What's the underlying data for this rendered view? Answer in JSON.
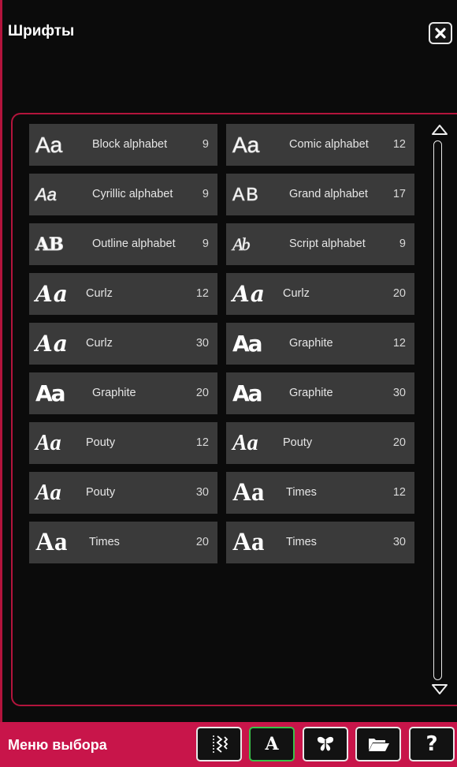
{
  "header": {
    "title": "Шрифты"
  },
  "fonts": [
    {
      "glyph": "Aa",
      "name": "Block alphabet",
      "size": "9",
      "style": "block"
    },
    {
      "glyph": "Aa",
      "name": "Comic alphabet",
      "size": "12",
      "style": "comic"
    },
    {
      "glyph": "Aa",
      "name": "Cyrillic alphabet",
      "size": "9",
      "style": "cyr"
    },
    {
      "glyph": "AB",
      "name": "Grand alphabet",
      "size": "17",
      "style": "grand"
    },
    {
      "glyph": "AB",
      "name": "Outline alphabet",
      "size": "9",
      "style": "outline"
    },
    {
      "glyph": "Ab",
      "name": "Script alphabet",
      "size": "9",
      "style": "script"
    },
    {
      "glyph": "Aa",
      "name": "Curlz",
      "size": "12",
      "style": "curlz"
    },
    {
      "glyph": "Aa",
      "name": "Curlz",
      "size": "20",
      "style": "curlz"
    },
    {
      "glyph": "Aa",
      "name": "Curlz",
      "size": "30",
      "style": "curlz"
    },
    {
      "glyph": "Aa",
      "name": "Graphite",
      "size": "12",
      "style": "graphite"
    },
    {
      "glyph": "Aa",
      "name": "Graphite",
      "size": "20",
      "style": "graphite"
    },
    {
      "glyph": "Aa",
      "name": "Graphite",
      "size": "30",
      "style": "graphite"
    },
    {
      "glyph": "Aa",
      "name": "Pouty",
      "size": "12",
      "style": "pouty"
    },
    {
      "glyph": "Aa",
      "name": "Pouty",
      "size": "20",
      "style": "pouty"
    },
    {
      "glyph": "Aa",
      "name": "Pouty",
      "size": "30",
      "style": "pouty"
    },
    {
      "glyph": "Aa",
      "name": "Times",
      "size": "12",
      "style": "times"
    },
    {
      "glyph": "Aa",
      "name": "Times",
      "size": "20",
      "style": "times"
    },
    {
      "glyph": "Aa",
      "name": "Times",
      "size": "30",
      "style": "times"
    }
  ],
  "footer": {
    "label": "Меню выбора",
    "buttons": [
      {
        "icon": "stitch-icon"
      },
      {
        "icon": "font-icon",
        "glyph": "A",
        "active": true
      },
      {
        "icon": "butterfly-icon"
      },
      {
        "icon": "folder-icon"
      },
      {
        "icon": "help-icon",
        "glyph": "?"
      }
    ]
  },
  "colors": {
    "accent": "#c8154a",
    "tile": "#3a3a3a",
    "background": "#0b0b0b",
    "active": "#39c24a"
  }
}
